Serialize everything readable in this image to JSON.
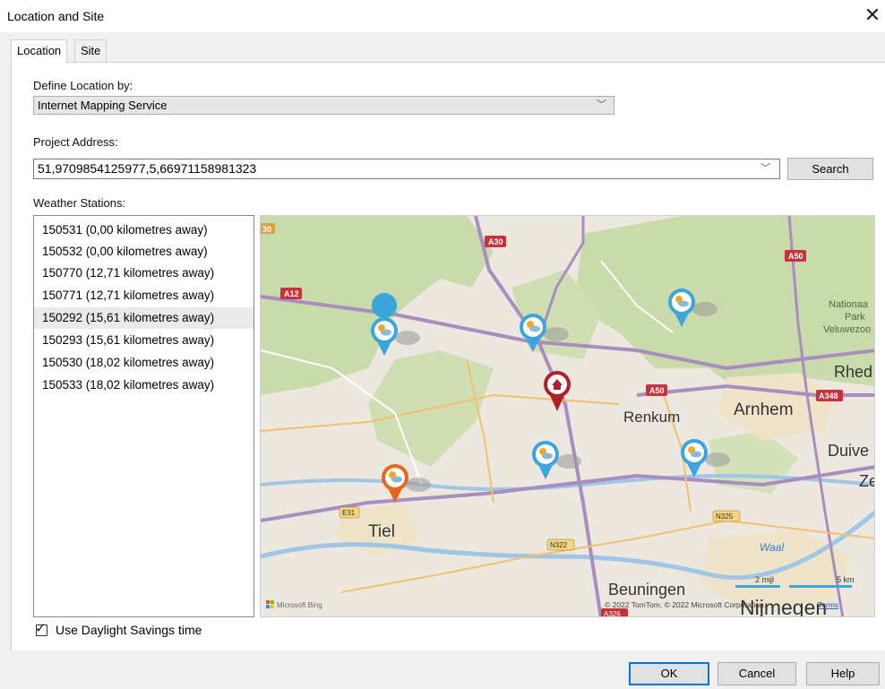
{
  "window": {
    "title": "Location and Site",
    "close_glyph": "✕"
  },
  "tabs": [
    {
      "label": "Location",
      "active": true
    },
    {
      "label": "Site",
      "active": false
    }
  ],
  "define_location": {
    "label": "Define Location by:",
    "value": "Internet Mapping Service"
  },
  "project_address": {
    "label": "Project Address:",
    "value": "51,9709854125977,5,66971158981323",
    "search_label": "Search"
  },
  "weather": {
    "label": "Weather Stations:",
    "stations": [
      "150531 (0,00 kilometres away)",
      "150532 (0,00 kilometres away)",
      "150770 (12,71 kilometres away)",
      "150771 (12,71 kilometres away)",
      "150292 (15,61 kilometres away)",
      "150293 (15,61 kilometres away)",
      "150530 (18,02 kilometres away)",
      "150533 (18,02 kilometres away)"
    ],
    "highlighted_index": 4
  },
  "map": {
    "places": {
      "arnhem": "Arnhem",
      "renkum": "Renkum",
      "tiel": "Tiel",
      "beuningen": "Beuningen",
      "nijmegen": "Nijmegen",
      "duive": "Duive",
      "ze": "Ze",
      "rhed": "Rhed",
      "waal": "Waal",
      "park": [
        "Nationaa",
        "Park",
        "Veluwezoo"
      ]
    },
    "road_shields": {
      "a30": "A30",
      "a30b": "30",
      "a50": "A50",
      "a50b": "A50",
      "a12": "A12",
      "a348": "A348",
      "e31": "E31",
      "n322": "N322",
      "n325": "N325",
      "a326": "A326"
    },
    "scale": {
      "miles": "2 mijl",
      "km": "5 km"
    },
    "copyright": "© 2022 TomTom, © 2022 Microsoft Corporation",
    "terms": "Terms",
    "provider": "Microsoft Bing",
    "colors": {
      "pin_blue": "#3aa6dc",
      "pin_orange": "#e8651d",
      "pin_home": "#b0202a",
      "forest": "#c7d9a6",
      "motorway": "#a98dbf"
    }
  },
  "daylight": {
    "label": "Use Daylight Savings time",
    "checked": true
  },
  "buttons": {
    "ok": "OK",
    "cancel": "Cancel",
    "help": "Help"
  }
}
